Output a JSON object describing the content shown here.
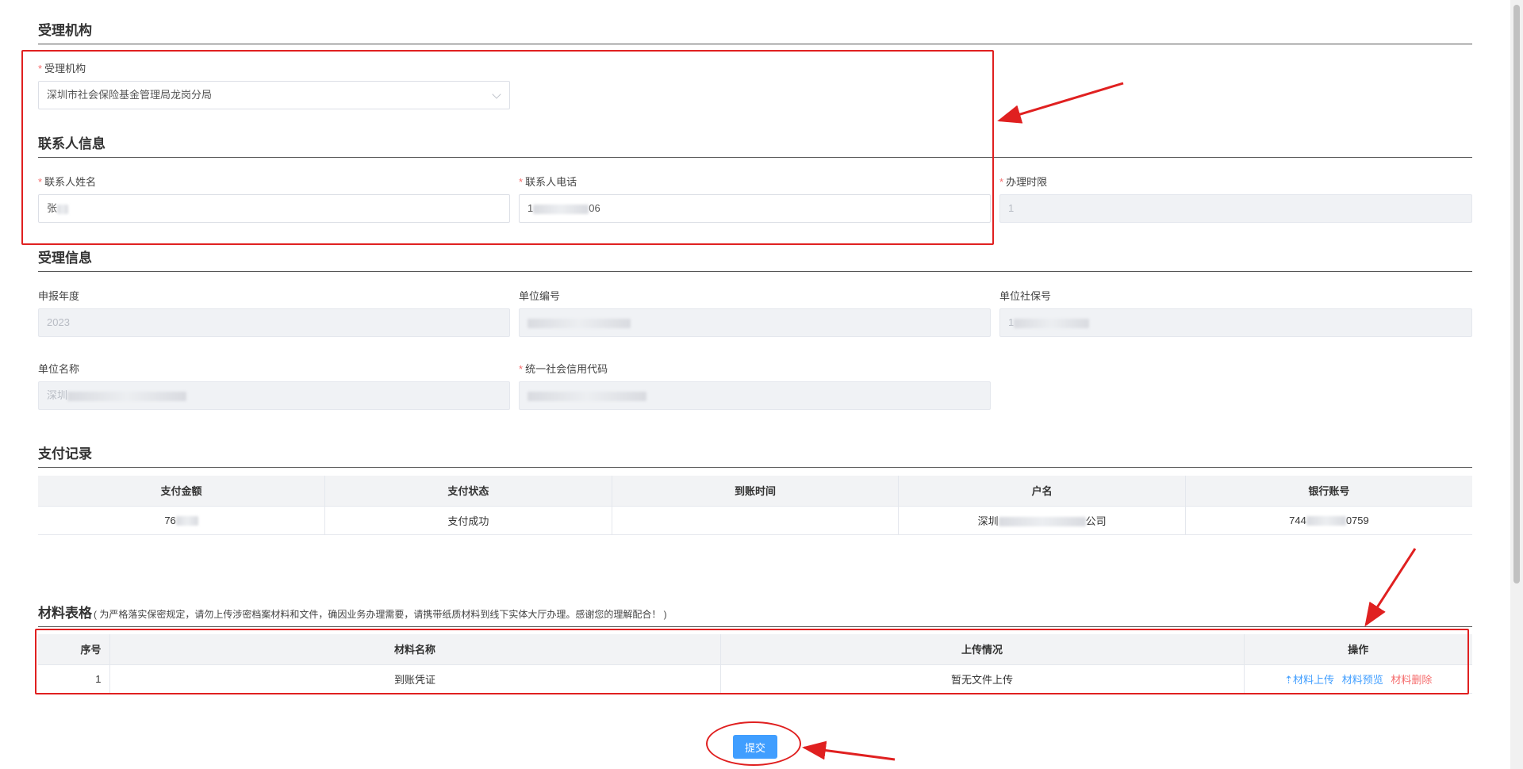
{
  "sections": {
    "agency": "受理机构",
    "contact": "联系人信息",
    "acceptance": "受理信息",
    "payment": "支付记录",
    "materials": "材料表格",
    "materials_note": "( 为严格落实保密规定，请勿上传涉密档案材料和文件，确因业务办理需要，请携带纸质材料到线下实体大厅办理。感谢您的理解配合！ )"
  },
  "agency": {
    "label": "受理机构",
    "value": "深圳市社会保险基金管理局龙岗分局"
  },
  "contact": {
    "name_label": "联系人姓名",
    "name_value": "张",
    "phone_label": "联系人电话",
    "phone_prefix": "1",
    "phone_suffix": "06",
    "deadline_label": "办理时限",
    "deadline_value": "1"
  },
  "acceptance": {
    "year_label": "申报年度",
    "year_value": "2023",
    "unit_no_label": "单位编号",
    "unit_ss_label": "单位社保号",
    "unit_ss_prefix": "1",
    "unit_name_label": "单位名称",
    "unit_name_prefix": "深圳",
    "credit_code_label": "统一社会信用代码"
  },
  "payment_table": {
    "headers": [
      "支付金额",
      "支付状态",
      "到账时间",
      "户名",
      "银行账号"
    ],
    "row": {
      "amount": "76",
      "status": "支付成功",
      "arrival_time": "",
      "account_name_prefix": "深圳",
      "account_name_suffix": "公司",
      "bank_prefix": "744",
      "bank_suffix": "0759"
    }
  },
  "materials_table": {
    "headers": [
      "序号",
      "材料名称",
      "上传情况",
      "操作"
    ],
    "row": {
      "index": "1",
      "name": "到账凭证",
      "upload_status": "暂无文件上传",
      "action_upload": "⇡材料上传",
      "action_preview": "材料预览",
      "action_delete": "材料删除"
    }
  },
  "submit_label": "提交",
  "colors": {
    "accent": "#409eff",
    "danger": "#f56c6c",
    "annotation": "#e02020"
  }
}
